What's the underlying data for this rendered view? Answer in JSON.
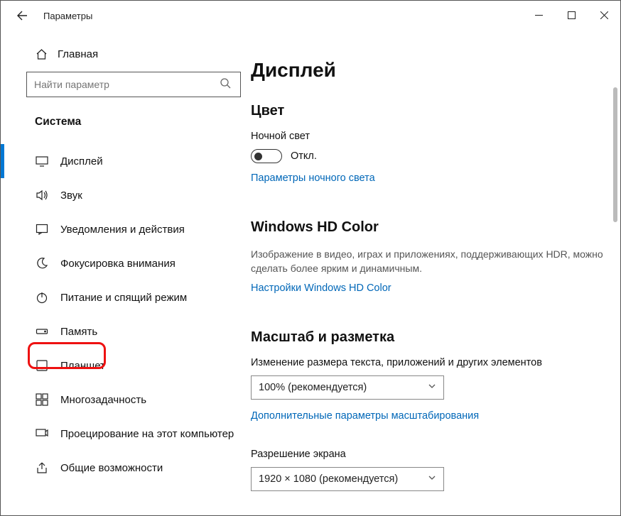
{
  "titlebar": {
    "title": "Параметры"
  },
  "sidebar": {
    "home_label": "Главная",
    "search_placeholder": "Найти параметр",
    "section_label": "Система",
    "items": [
      {
        "label": "Дисплей"
      },
      {
        "label": "Звук"
      },
      {
        "label": "Уведомления и действия"
      },
      {
        "label": "Фокусировка внимания"
      },
      {
        "label": "Питание и спящий режим"
      },
      {
        "label": "Память"
      },
      {
        "label": "Планшет"
      },
      {
        "label": "Многозадачность"
      },
      {
        "label": "Проецирование на этот компьютер"
      },
      {
        "label": "Общие возможности"
      }
    ]
  },
  "main": {
    "page_title": "Дисплей",
    "color": {
      "heading": "Цвет",
      "night_light_label": "Ночной свет",
      "toggle_state": "Откл.",
      "night_light_link": "Параметры ночного света"
    },
    "hdcolor": {
      "heading": "Windows HD Color",
      "desc": "Изображение в видео, играх и приложениях, поддерживающих HDR, можно сделать более ярким и динамичным.",
      "link": "Настройки Windows HD Color"
    },
    "scale": {
      "heading": "Масштаб и разметка",
      "scale_label": "Изменение размера текста, приложений и других элементов",
      "scale_value": "100% (рекомендуется)",
      "scale_link": "Дополнительные параметры масштабирования",
      "resolution_label": "Разрешение экрана",
      "resolution_value": "1920 × 1080 (рекомендуется)"
    }
  }
}
